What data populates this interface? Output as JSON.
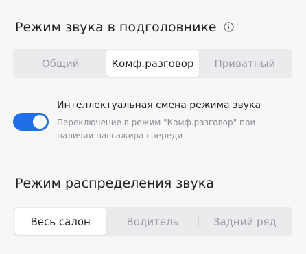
{
  "headrest_section": {
    "title": "Режим звука в подголовнике",
    "info_icon": "info-circle-icon",
    "options": [
      "Общий",
      "Комф.разговор",
      "Приватный"
    ],
    "selected": "Комф.разговор"
  },
  "smart_switch": {
    "label": "Интеллектуальная смена режима звука",
    "description": "Переключение в режим \"Комф.разговор\" при наличии пассажира спереди",
    "enabled": true
  },
  "distribution_section": {
    "title": "Режим распределения звука",
    "options": [
      "Весь салон",
      "Водитель",
      "Задний ряд"
    ],
    "selected": "Весь салон"
  },
  "colors": {
    "accent": "#1f6fe8",
    "background": "#f7f7f8",
    "segment_bg": "#ebebee"
  }
}
